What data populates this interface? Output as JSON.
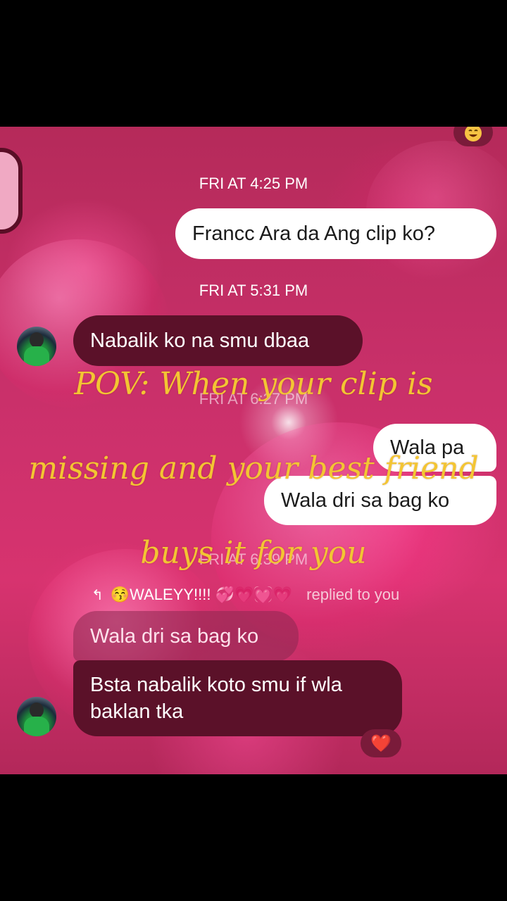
{
  "conversation": {
    "timestamp_1": "FRI AT 4:25 PM",
    "msg_1": "Francc Ara da Ang clip ko?",
    "timestamp_2": "FRI AT 5:31 PM",
    "msg_2": "Nabalik ko na smu dbaa",
    "timestamp_3": "FRI AT 6:27 PM",
    "msg_3": "Wala pa",
    "msg_4": "Wala dri sa bag ko",
    "timestamp_4": "FRI AT 6:39 PM",
    "reply_banner": {
      "name": "😚WALEYY!!!! 💞💗💓💗",
      "suffix": "replied to you",
      "quoted": "Wala dri sa bag ko"
    },
    "msg_5": "Bsta nabalik koto smu if wla baklan tka",
    "reaction": "❤️"
  },
  "caption": {
    "line_1": "POV: When your clip is",
    "line_2": "missing and your best friend",
    "line_3": "buys it for you"
  },
  "icons": {
    "corner": "emoji-face-icon",
    "reply": "reply-arrow-icon",
    "avatar": "contact-avatar"
  }
}
